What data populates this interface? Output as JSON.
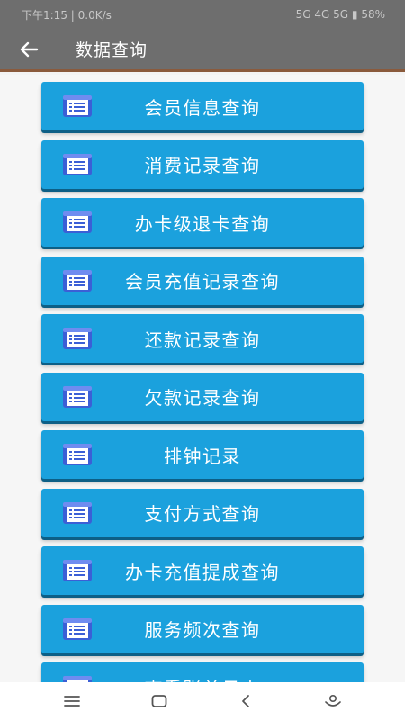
{
  "status_bar": {
    "left_text": "下午1:15 | 0.0K/s",
    "right_text": "5G  4G  5G  ▮ 58%"
  },
  "app_bar": {
    "title": "数据查询"
  },
  "menu": {
    "items": [
      {
        "label": "会员信息查询",
        "icon": "document-list-icon"
      },
      {
        "label": "消费记录查询",
        "icon": "document-list-icon"
      },
      {
        "label": "办卡级退卡查询",
        "icon": "document-list-icon"
      },
      {
        "label": "会员充值记录查询",
        "icon": "document-list-icon"
      },
      {
        "label": "还款记录查询",
        "icon": "document-list-icon"
      },
      {
        "label": "欠款记录查询",
        "icon": "document-list-icon"
      },
      {
        "label": "排钟记录",
        "icon": "document-list-icon"
      },
      {
        "label": "支付方式查询",
        "icon": "document-list-icon"
      },
      {
        "label": "办卡充值提成查询",
        "icon": "document-list-icon"
      },
      {
        "label": "服务频次查询",
        "icon": "document-list-icon"
      },
      {
        "label": "查看账单日志",
        "icon": "document-list-icon"
      }
    ]
  },
  "nav_bar": {
    "icons": [
      "menu-icon",
      "home-icon",
      "back-icon",
      "assistant-icon"
    ]
  },
  "colors": {
    "app_bar": "#6e6e6e",
    "button": "#1ba1dd",
    "button_shadow": "#0d5f86",
    "accent_line": "#8a5a3c"
  }
}
